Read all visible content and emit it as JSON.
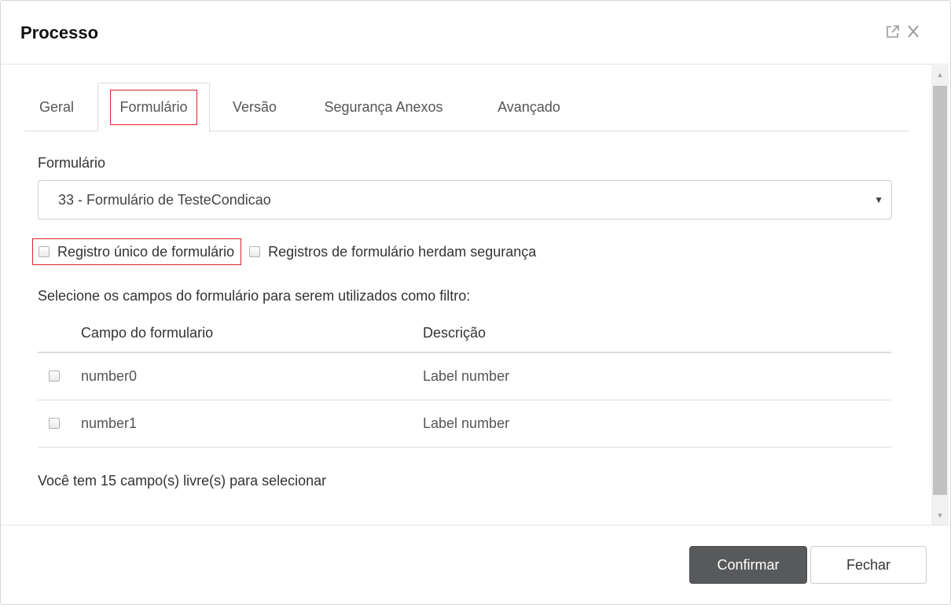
{
  "dialog": {
    "title": "Processo"
  },
  "tabs": [
    {
      "label": "Geral",
      "active": false
    },
    {
      "label": "Formulário",
      "active": true
    },
    {
      "label": "Versão",
      "active": false
    },
    {
      "label": "Segurança Anexos",
      "active": false
    },
    {
      "label": "Avançado",
      "active": false
    }
  ],
  "form": {
    "field_label": "Formulário",
    "selected_form": "33 - Formulário de TesteCondicao"
  },
  "options": {
    "unique_record": {
      "label": "Registro único de formulário",
      "checked": false
    },
    "inherit_security": {
      "label": "Registros de formulário herdam segurança",
      "checked": false
    }
  },
  "filter": {
    "instruction": "Selecione os campos do formulário para serem utilizados como filtro:",
    "columns": [
      "Campo do formulario",
      "Descrição"
    ],
    "rows": [
      {
        "field": "number0",
        "description": "Label number",
        "checked": false
      },
      {
        "field": "number1",
        "description": "Label number",
        "checked": false
      }
    ],
    "free_fields_text": "Você tem 15 campo(s) livre(s) para selecionar"
  },
  "footer": {
    "confirm_label": "Confirmar",
    "close_label": "Fechar"
  },
  "colors": {
    "highlight": "#d9232d",
    "primary_button": "#58595b"
  },
  "icons": {
    "popout": "external-link-icon",
    "close": "close-icon",
    "select_caret": "caret-down-icon"
  }
}
